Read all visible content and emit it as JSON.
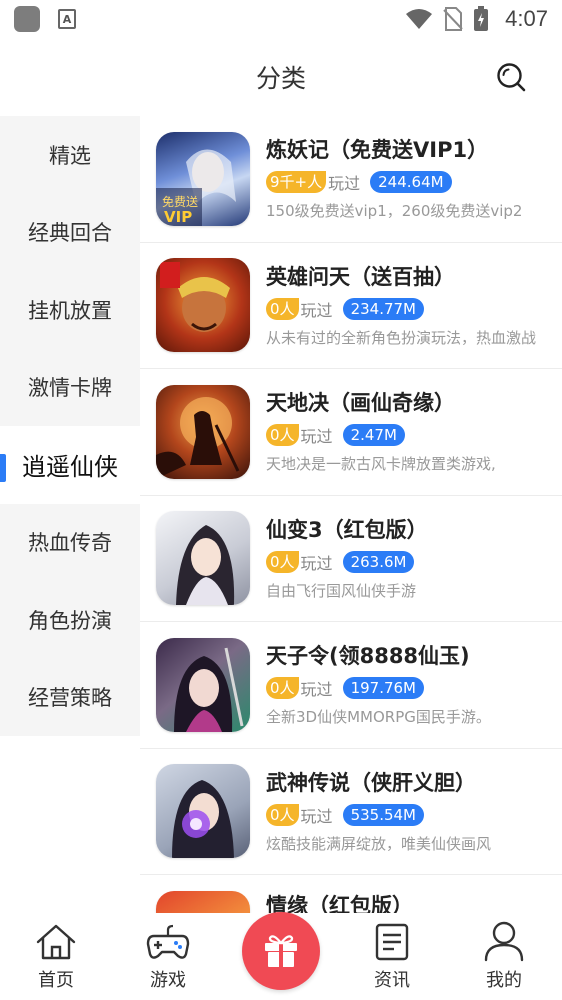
{
  "status_bar": {
    "time": "4:07",
    "icons": [
      "app-icon",
      "a-icon",
      "wifi-icon",
      "no-sim-icon",
      "battery-charging-icon"
    ]
  },
  "header": {
    "title": "分类",
    "search_icon": "search-icon"
  },
  "sidebar": {
    "items": [
      {
        "label": "精选"
      },
      {
        "label": "经典回合"
      },
      {
        "label": "挂机放置"
      },
      {
        "label": "激情卡牌"
      },
      {
        "label": "逍遥仙侠",
        "active": true
      },
      {
        "label": "热血传奇"
      },
      {
        "label": "角色扮演"
      },
      {
        "label": "经营策略"
      }
    ],
    "accent_color": "#2b7cf6"
  },
  "games": [
    {
      "name": "炼妖记（免费送VIP1）",
      "players": "9千+人",
      "played": "玩过",
      "size": "244.64M",
      "desc": "150级免费送vip1，260级免费送vip2",
      "icon_badge": "免费送"
    },
    {
      "name": "英雄问天（送百抽）",
      "players": "0人",
      "played": "玩过",
      "size": "234.77M",
      "desc": "从未有过的全新角色扮演玩法，热血激战",
      "icon_badge": ""
    },
    {
      "name": "天地决（画仙奇缘）",
      "players": "0人",
      "played": "玩过",
      "size": "2.47M",
      "desc": "天地决是一款古风卡牌放置类游戏,",
      "icon_badge": ""
    },
    {
      "name": "仙变3（红包版）",
      "players": "0人",
      "played": "玩过",
      "size": "263.6M",
      "desc": "自由飞行国风仙侠手游",
      "icon_badge": ""
    },
    {
      "name": "天子令(领8888仙玉)",
      "players": "0人",
      "played": "玩过",
      "size": "197.76M",
      "desc": "全新3D仙侠MMORPG国民手游。",
      "icon_badge": ""
    },
    {
      "name": "武神传说（侠肝义胆）",
      "players": "0人",
      "played": "玩过",
      "size": "535.54M",
      "desc": "炫酷技能满屏绽放，唯美仙侠画风",
      "icon_badge": ""
    },
    {
      "name": "情缘（红包版）",
      "players": "",
      "played": "",
      "size": "",
      "desc": "",
      "icon_badge": ""
    }
  ],
  "colors": {
    "players_badge": "#f5b52a",
    "size_badge": "#2b7cf6",
    "gift_button": "#f04a54"
  },
  "bottom_nav": {
    "home": "首页",
    "games": "游戏",
    "news": "资讯",
    "mine": "我的",
    "gift_icon": "gift-icon"
  }
}
